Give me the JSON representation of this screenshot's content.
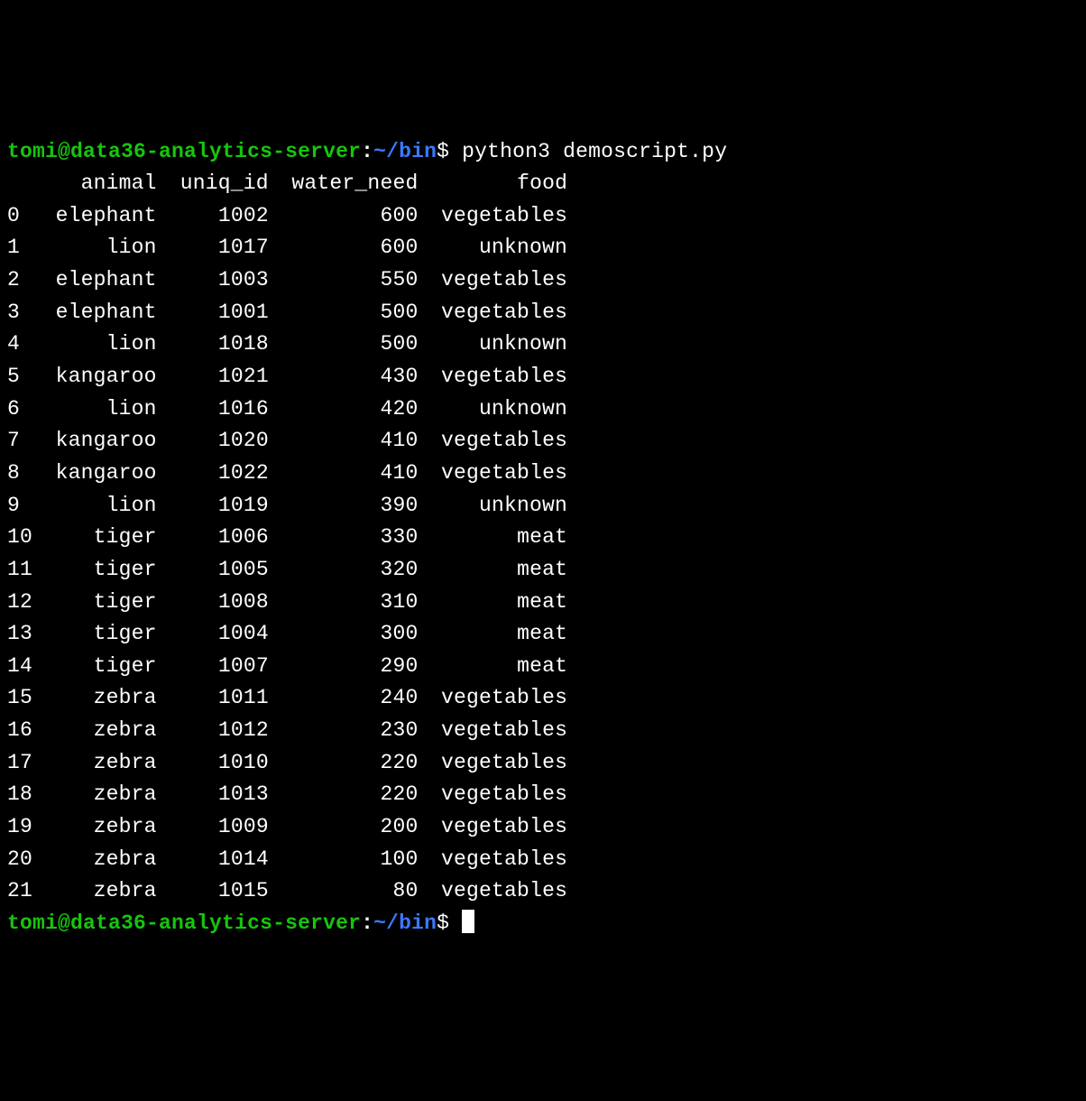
{
  "prompt1": {
    "user": "tomi",
    "at": "@",
    "host": "data36-analytics-server",
    "sep": ":",
    "path": "~/bin",
    "dollar": "$",
    "command": " python3 demoscript.py"
  },
  "prompt2": {
    "user": "tomi",
    "at": "@",
    "host": "data36-analytics-server",
    "sep": ":",
    "path": "~/bin",
    "dollar": "$",
    "command": " "
  },
  "table": {
    "columns": [
      "animal",
      "uniq_id",
      "water_need",
      "food"
    ],
    "rows": [
      {
        "idx": "0",
        "animal": "elephant",
        "uniq_id": "1002",
        "water_need": "600",
        "food": "vegetables"
      },
      {
        "idx": "1",
        "animal": "lion",
        "uniq_id": "1017",
        "water_need": "600",
        "food": "unknown"
      },
      {
        "idx": "2",
        "animal": "elephant",
        "uniq_id": "1003",
        "water_need": "550",
        "food": "vegetables"
      },
      {
        "idx": "3",
        "animal": "elephant",
        "uniq_id": "1001",
        "water_need": "500",
        "food": "vegetables"
      },
      {
        "idx": "4",
        "animal": "lion",
        "uniq_id": "1018",
        "water_need": "500",
        "food": "unknown"
      },
      {
        "idx": "5",
        "animal": "kangaroo",
        "uniq_id": "1021",
        "water_need": "430",
        "food": "vegetables"
      },
      {
        "idx": "6",
        "animal": "lion",
        "uniq_id": "1016",
        "water_need": "420",
        "food": "unknown"
      },
      {
        "idx": "7",
        "animal": "kangaroo",
        "uniq_id": "1020",
        "water_need": "410",
        "food": "vegetables"
      },
      {
        "idx": "8",
        "animal": "kangaroo",
        "uniq_id": "1022",
        "water_need": "410",
        "food": "vegetables"
      },
      {
        "idx": "9",
        "animal": "lion",
        "uniq_id": "1019",
        "water_need": "390",
        "food": "unknown"
      },
      {
        "idx": "10",
        "animal": "tiger",
        "uniq_id": "1006",
        "water_need": "330",
        "food": "meat"
      },
      {
        "idx": "11",
        "animal": "tiger",
        "uniq_id": "1005",
        "water_need": "320",
        "food": "meat"
      },
      {
        "idx": "12",
        "animal": "tiger",
        "uniq_id": "1008",
        "water_need": "310",
        "food": "meat"
      },
      {
        "idx": "13",
        "animal": "tiger",
        "uniq_id": "1004",
        "water_need": "300",
        "food": "meat"
      },
      {
        "idx": "14",
        "animal": "tiger",
        "uniq_id": "1007",
        "water_need": "290",
        "food": "meat"
      },
      {
        "idx": "15",
        "animal": "zebra",
        "uniq_id": "1011",
        "water_need": "240",
        "food": "vegetables"
      },
      {
        "idx": "16",
        "animal": "zebra",
        "uniq_id": "1012",
        "water_need": "230",
        "food": "vegetables"
      },
      {
        "idx": "17",
        "animal": "zebra",
        "uniq_id": "1010",
        "water_need": "220",
        "food": "vegetables"
      },
      {
        "idx": "18",
        "animal": "zebra",
        "uniq_id": "1013",
        "water_need": "220",
        "food": "vegetables"
      },
      {
        "idx": "19",
        "animal": "zebra",
        "uniq_id": "1009",
        "water_need": "200",
        "food": "vegetables"
      },
      {
        "idx": "20",
        "animal": "zebra",
        "uniq_id": "1014",
        "water_need": "100",
        "food": "vegetables"
      },
      {
        "idx": "21",
        "animal": "zebra",
        "uniq_id": "1015",
        "water_need": "80",
        "food": "vegetables"
      }
    ]
  }
}
